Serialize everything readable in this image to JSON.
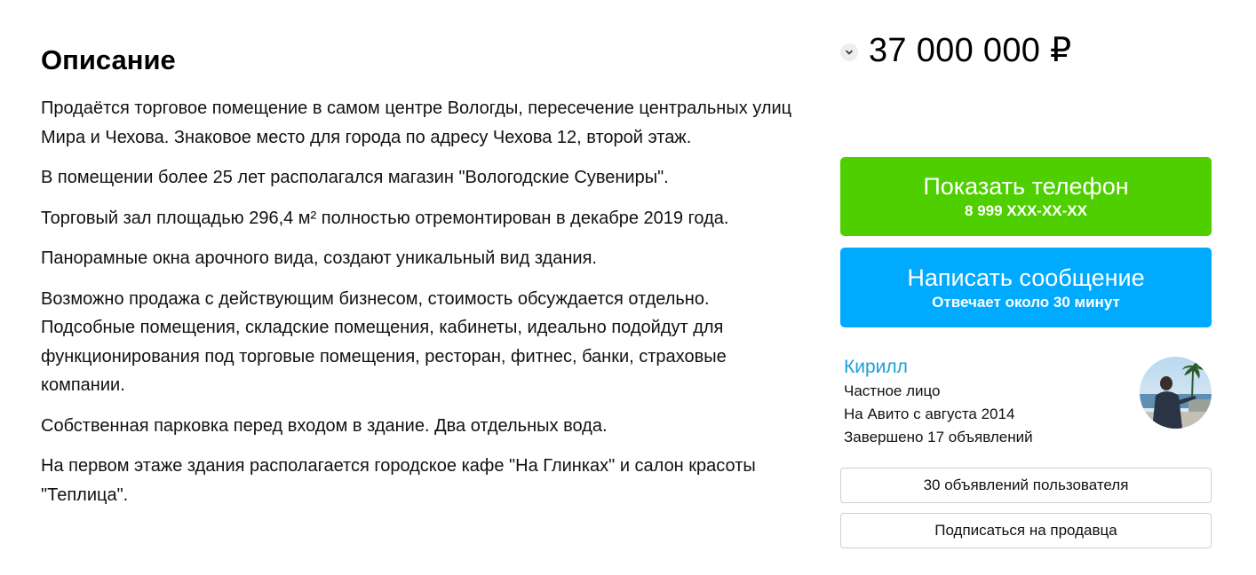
{
  "description": {
    "heading": "Описание",
    "paragraphs": [
      "Продаётся торговое помещение в самом центре Вологды, пересечение центральных улиц Мира и Чехова. Знаковое место для города по адресу Чехова 12, второй этаж.",
      "В помещении более 25 лет располагался магазин \"Вологодские Сувениры\".",
      "Торговый зал площадью 296,4 м² полностью отремонтирован в декабре 2019 года.",
      "Панорамные окна арочного вида, создают уникальный вид здания.",
      "Возможно продажа с действующим бизнесом, стоимость обсуждается отдельно. Подсобные помещения, складские помещения, кабинеты, идеально подойдут для функционирования под торговые помещения, ресторан, фитнес, банки, страховые компании.",
      "Собственная парковка перед входом в здание. Два отдельных вода.",
      "На первом этаже здания располагается городское кафе \"На Глинках\" и салон красоты \"Теплица\"."
    ]
  },
  "price": {
    "value": "37 000 000 ₽",
    "toggle_icon": "chevron-down-icon"
  },
  "phone_button": {
    "label": "Показать телефон",
    "number": "8 999 XXX-XX-XX",
    "color": "#4fcf00"
  },
  "message_button": {
    "label": "Написать сообщение",
    "note": "Отвечает около 30 минут",
    "color": "#00aaff"
  },
  "seller": {
    "name": "Кирилл",
    "type": "Частное лицо",
    "since": "На Авито с августа 2014",
    "completed": "Завершено 17 объявлений",
    "name_color": "#1a9fd9"
  },
  "actions": {
    "listings": "30 объявлений пользователя",
    "subscribe": "Подписаться на продавца"
  }
}
